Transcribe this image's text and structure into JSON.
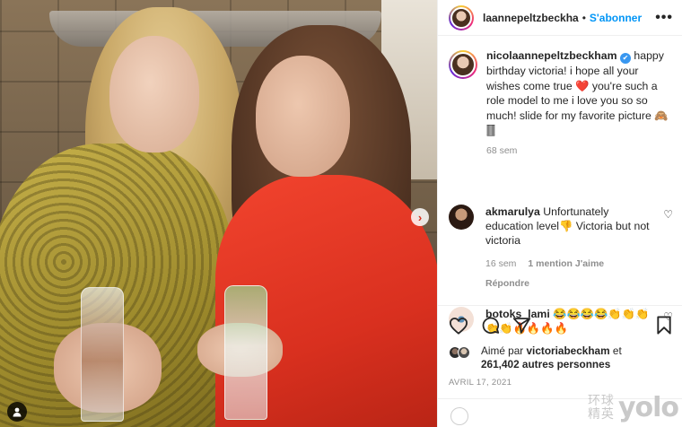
{
  "post": {
    "author": "laannepeltzbeckha",
    "separator": "•",
    "follow_label": "S'abonner",
    "more_label": "•••"
  },
  "caption": {
    "username": "nicolaannepeltzbeckham",
    "verified_mark": "✔",
    "text": "happy birthday victoria! i hope all your wishes come true ❤️  you're such a role model to me i love you so so much! slide for my favorite picture 🙈🀫",
    "time": "68 sem"
  },
  "comments": [
    {
      "username": "akmarulya",
      "text": "Unfortunately education level👎 Victoria but not victoria",
      "time": "16 sem",
      "mentions": "1 mention J'aime",
      "reply_label": "Répondre"
    },
    {
      "username": "botoks_lami",
      "text": "😂😂😂😂👏👏👏👏👏🔥🔥🔥🔥"
    }
  ],
  "likes": {
    "liked_by_prefix": "Aimé par",
    "liked_by_user": "victoriabeckham",
    "and": "et",
    "others": "261,402 autres personnes"
  },
  "date": "AVRIL 17, 2021",
  "watermark": {
    "cn": "环球精英",
    "brand": "yolo"
  },
  "icons": {
    "like": "heart-icon",
    "comment": "comment-icon",
    "share": "paper-plane-icon",
    "save": "bookmark-icon",
    "tag": "user-tag-icon",
    "next": "chevron-right-icon"
  },
  "colors": {
    "follow_blue": "#0095f6",
    "verified_blue": "#3897f0",
    "meta_gray": "#8e8e8e"
  }
}
